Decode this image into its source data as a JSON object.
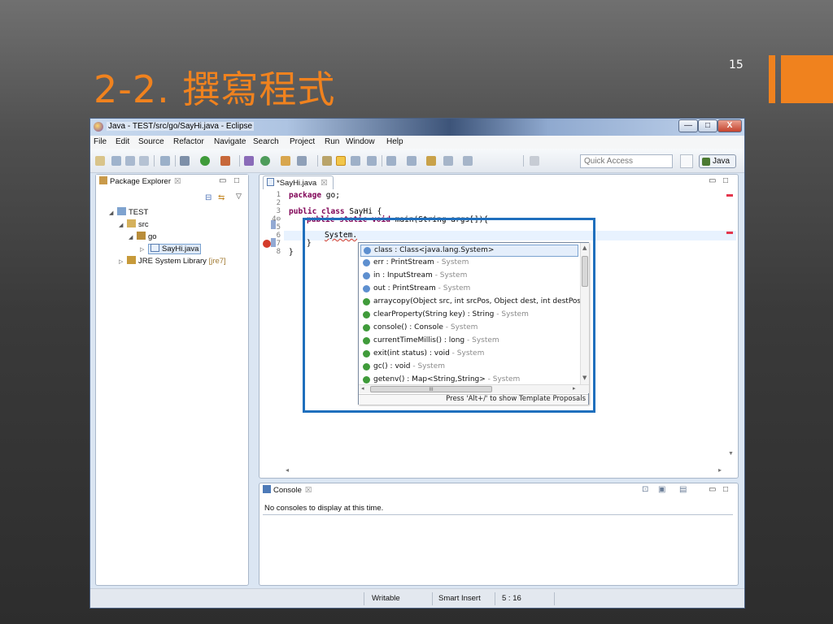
{
  "slide": {
    "title": "2-2. 撰寫程式",
    "page_number": "15",
    "accent_color": "#f0821e"
  },
  "window": {
    "title": "Java - TEST/src/go/SayHi.java - Eclipse",
    "buttons": {
      "minimize": "—",
      "maximize": "□",
      "close": "X"
    }
  },
  "menubar": {
    "items": [
      "File",
      "Edit",
      "Source",
      "Refactor",
      "Navigate",
      "Search",
      "Project",
      "Run",
      "Window",
      "Help"
    ]
  },
  "toolbar": {
    "quick_access_placeholder": "Quick Access",
    "perspective_label": "Java"
  },
  "package_explorer": {
    "tab_label": "Package Explorer",
    "tab_close": "☒",
    "tree": {
      "project": "TEST",
      "src": "src",
      "package": "go",
      "file": "SayHi.java",
      "jre_label": "JRE System Library",
      "jre_version": "[jre7]"
    }
  },
  "editor": {
    "tab_label": "*SayHi.java",
    "tab_close": "☒",
    "line_numbers": [
      "1",
      "2",
      "3",
      "4⊖",
      "5",
      "6",
      "7",
      "8"
    ],
    "lines": {
      "l1_kw": "package",
      "l1_rest": " go;",
      "l3_kw": "public class",
      "l3_rest": " SayHi {",
      "l4_kw": "public static void",
      "l4_rest": " main(String args[]){",
      "l5": "System.",
      "l6": "}",
      "l7": "}"
    }
  },
  "content_assist": {
    "items": [
      {
        "text": "class : Class<java.lang.System>",
        "suffix": "",
        "icon": "static-field-icon"
      },
      {
        "text": "err : PrintStream",
        "suffix": " - System",
        "icon": "static-final-field-icon"
      },
      {
        "text": "in : InputStream",
        "suffix": " - System",
        "icon": "static-final-field-icon"
      },
      {
        "text": "out : PrintStream",
        "suffix": " - System",
        "icon": "static-final-field-icon"
      },
      {
        "text": "arraycopy(Object src, int srcPos, Object dest, int destPos,",
        "suffix": "",
        "icon": "static-method-icon"
      },
      {
        "text": "clearProperty(String key) : String",
        "suffix": " - System",
        "icon": "static-method-icon"
      },
      {
        "text": "console() : Console",
        "suffix": " - System",
        "icon": "static-method-icon"
      },
      {
        "text": "currentTimeMillis() : long",
        "suffix": " - System",
        "icon": "static-method-icon"
      },
      {
        "text": "exit(int status) : void",
        "suffix": " - System",
        "icon": "static-method-icon"
      },
      {
        "text": "gc() : void",
        "suffix": " - System",
        "icon": "static-method-icon"
      },
      {
        "text": "getenv() : Map<String,String>",
        "suffix": " - System",
        "icon": "static-method-icon"
      }
    ],
    "footer": "Press 'Alt+/' to show Template Proposals",
    "hscroll_mark": "III"
  },
  "console": {
    "tab_label": "Console",
    "tab_close": "☒",
    "message": "No consoles to display at this time."
  },
  "statusbar": {
    "writable": "Writable",
    "insert_mode": "Smart Insert",
    "position": "5 : 16"
  }
}
